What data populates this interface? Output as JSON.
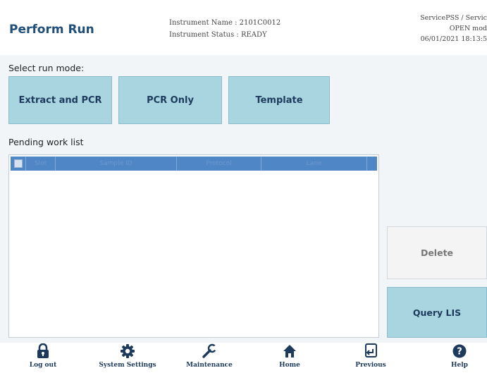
{
  "header": {
    "title": "Perform Run",
    "instrument_name": "Instrument Name : 2101C0012",
    "instrument_status": "Instrument Status : READY",
    "user": "ServicePSS / Servic",
    "mode": "OPEN mod",
    "datetime": "06/01/2021 18:13:5"
  },
  "run_mode": {
    "label": "Select run mode:",
    "buttons": [
      "Extract and PCR",
      "PCR Only",
      "Template"
    ]
  },
  "worklist": {
    "label": "Pending work list",
    "columns": [
      "Slot",
      "Sample ID",
      "Protocol",
      "Lane"
    ],
    "rows": []
  },
  "actions": {
    "delete": "Delete",
    "query": "Query LIS"
  },
  "nav": [
    {
      "label": "Log out",
      "icon": "lock-icon"
    },
    {
      "label": "System Settings",
      "icon": "gear-icon"
    },
    {
      "label": "Maintenance",
      "icon": "wrench-icon"
    },
    {
      "label": "Home",
      "icon": "home-icon"
    },
    {
      "label": "Previous",
      "icon": "previous-icon"
    },
    {
      "label": "Help",
      "icon": "help-icon"
    }
  ],
  "colors": {
    "accent": "#a9d5e1",
    "title": "#1f4e79",
    "table_header": "#4f86c6",
    "nav_text": "#1d3a5c"
  }
}
